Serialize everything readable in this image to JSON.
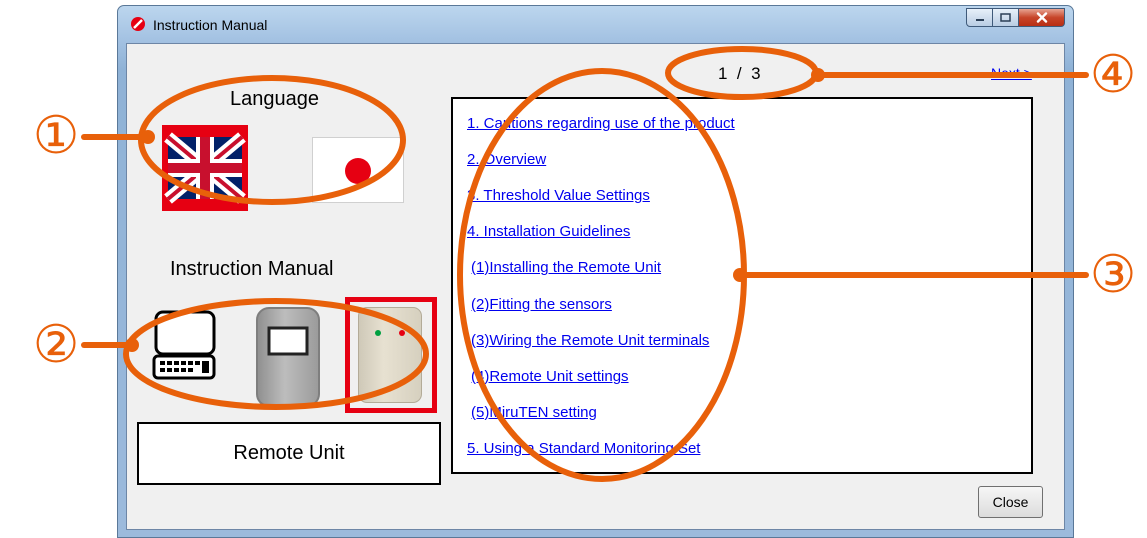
{
  "window": {
    "title": "Instruction Manual"
  },
  "language": {
    "label": "Language",
    "options": [
      "English",
      "Japanese"
    ]
  },
  "manual": {
    "label": "Instruction Manual",
    "selected_unit": "Remote Unit"
  },
  "pager": {
    "indicator": "1  /  3",
    "next": "Next >"
  },
  "toc": [
    "1. Cautions regarding use of the product",
    "2. Overview",
    "3. Threshold Value Settings",
    "4. Installation Guidelines",
    "  (1)Installing the Remote Unit",
    "  (2)Fitting the sensors",
    "  (3)Wiring the Remote Unit terminals",
    "  (4)Remote Unit settings",
    "  (5)MiruTEN setting",
    "5. Using a Standard Monitoring Set"
  ],
  "buttons": {
    "close": "Close"
  },
  "callouts": [
    "①",
    "②",
    "③",
    "④"
  ],
  "colors": {
    "annotation": "#e8600a",
    "link": "#0000ee",
    "selection": "#e60012"
  }
}
